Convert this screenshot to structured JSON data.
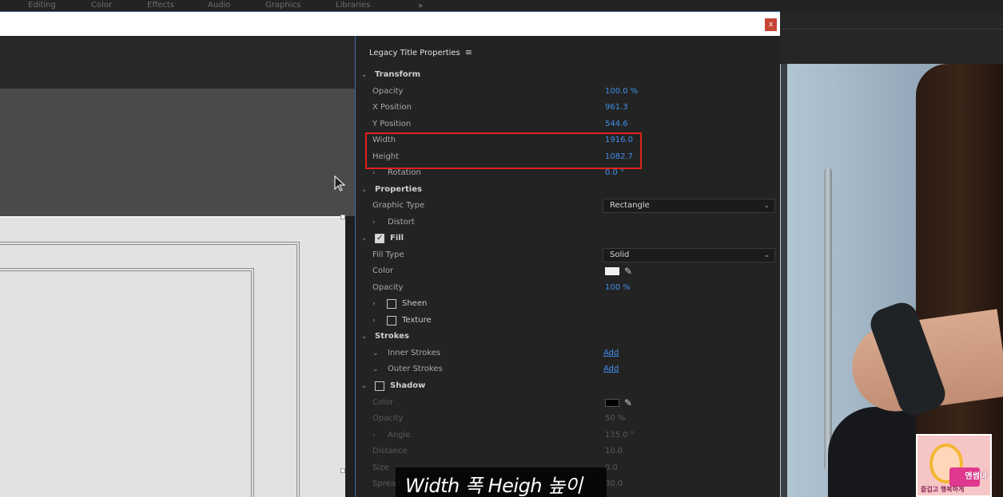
{
  "background_app": {
    "menu": [
      {
        "label": "Editing"
      },
      {
        "label": "Color"
      },
      {
        "label": "Effects"
      },
      {
        "label": "Audio"
      },
      {
        "label": "Graphics"
      },
      {
        "label": "Libraries"
      }
    ],
    "more": "»"
  },
  "window": {
    "close": "x"
  },
  "panel": {
    "title": "Legacy Title Properties",
    "menu_icon": "≡",
    "transform": {
      "label": "Transform",
      "opacity": {
        "label": "Opacity",
        "value": "100.0 %"
      },
      "x_position": {
        "label": "X Position",
        "value": "961.3"
      },
      "y_position": {
        "label": "Y Position",
        "value": "544.6"
      },
      "width": {
        "label": "Width",
        "value": "1916.0"
      },
      "height": {
        "label": "Height",
        "value": "1082.7"
      },
      "rotation": {
        "label": "Rotation",
        "value": "0.0 °"
      }
    },
    "properties": {
      "label": "Properties",
      "graphic_type": {
        "label": "Graphic Type",
        "value": "Rectangle"
      },
      "distort": {
        "label": "Distort"
      }
    },
    "fill": {
      "label": "Fill",
      "checked": true,
      "fill_type": {
        "label": "Fill Type",
        "value": "Solid"
      },
      "color": {
        "label": "Color",
        "swatch": "#f0f0f0"
      },
      "opacity": {
        "label": "Opacity",
        "value": "100 %"
      },
      "sheen": {
        "label": "Sheen",
        "checked": false
      },
      "texture": {
        "label": "Texture",
        "checked": false
      }
    },
    "strokes": {
      "label": "Strokes",
      "inner": {
        "label": "Inner Strokes",
        "action": "Add"
      },
      "outer": {
        "label": "Outer Strokes",
        "action": "Add"
      }
    },
    "shadow": {
      "label": "Shadow",
      "checked": false,
      "color": {
        "label": "Color",
        "swatch": "#000000"
      },
      "opacity": {
        "label": "Opacity",
        "value": "50 %"
      },
      "angle": {
        "label": "Angle",
        "value": "135.0 °"
      },
      "distance": {
        "label": "Distance",
        "value": "10.0"
      },
      "size": {
        "label": "Size",
        "value": "0.0"
      },
      "spread": {
        "label": "Spread",
        "value": "30.0"
      }
    }
  },
  "caption": {
    "text": "Width 폭  Heigh 높이"
  },
  "logo": {
    "text": "앤썸녀",
    "subtext": "즐겁고 행복하게"
  },
  "colors": {
    "accent_link": "#3f8fea",
    "highlight_box": "#e0221a",
    "close_button": "#c84536"
  }
}
